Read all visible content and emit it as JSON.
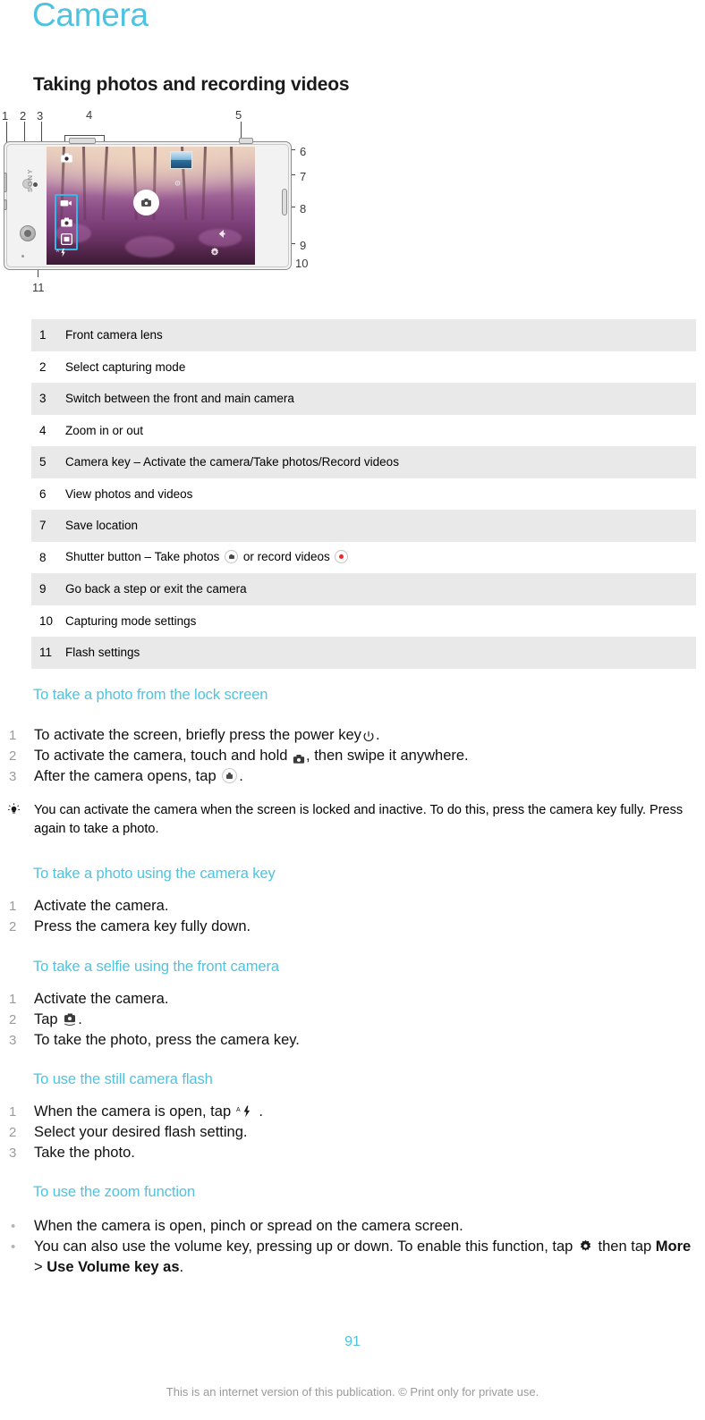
{
  "document": {
    "title": "Camera",
    "section_heading": "Taking photos and recording videos",
    "page_number": "91",
    "footer_note": "This is an internet version of this publication. © Print only for private use.",
    "accent_color": "#4ec3e0",
    "row_shade_color": "#e9e9e9"
  },
  "figure": {
    "name": "camera-screen-callout-diagram",
    "callout_numbers": [
      "1",
      "2",
      "3",
      "4",
      "5",
      "6",
      "7",
      "8",
      "9",
      "10",
      "11"
    ],
    "brand_text": "SONY",
    "highlight_color": "#39b6e8"
  },
  "reference_table": {
    "rows": [
      {
        "num": "1",
        "desc": "Front camera lens"
      },
      {
        "num": "2",
        "desc": "Select capturing mode"
      },
      {
        "num": "3",
        "desc": "Switch between the front and main camera"
      },
      {
        "num": "4",
        "desc": "Zoom in or out"
      },
      {
        "num": "5",
        "desc": "Camera key – Activate the camera/Take photos/Record videos"
      },
      {
        "num": "6",
        "desc": "View photos and videos"
      },
      {
        "num": "7",
        "desc": "Save location"
      },
      {
        "num": "8",
        "desc_before": "Shutter button – Take photos",
        "desc_middle": "or record videos",
        "desc_after": ""
      },
      {
        "num": "9",
        "desc": "Go back a step or exit the camera"
      },
      {
        "num": "10",
        "desc": "Capturing mode settings"
      },
      {
        "num": "11",
        "desc": "Flash settings"
      }
    ]
  },
  "sections": {
    "lock_screen": {
      "heading": "To take a photo from the lock screen",
      "step1_a": "To activate the screen, briefly press the power key",
      "step1_b": ".",
      "step2_a": "To activate the camera, touch and hold",
      "step2_b": ", then swipe it anywhere.",
      "step3_a": "After the camera opens, tap",
      "step3_b": ".",
      "markers": [
        "1",
        "2",
        "3"
      ],
      "tip": "You can activate the camera when the screen is locked and inactive. To do this, press the camera key fully. Press again to take a photo."
    },
    "camera_key": {
      "heading": "To take a photo using the camera key",
      "markers": [
        "1",
        "2"
      ],
      "steps": [
        "Activate the camera.",
        "Press the camera key fully down."
      ]
    },
    "selfie": {
      "heading": "To take a selfie using the front camera",
      "markers": [
        "1",
        "2",
        "3"
      ],
      "step1": "Activate the camera.",
      "step2_a": "Tap",
      "step2_b": ".",
      "step3": "To take the photo, press the camera key."
    },
    "flash": {
      "heading": "To use the still camera flash",
      "markers": [
        "1",
        "2",
        "3"
      ],
      "step1_a": "When the camera is open, tap",
      "step1_b": ".",
      "step2": "Select your desired flash setting.",
      "step3": "Take the photo."
    },
    "zoom": {
      "heading": "To use the zoom function",
      "markers": [
        "•",
        "•"
      ],
      "bullet1": "When the camera is open, pinch or spread on the camera screen.",
      "bullet2_a": "You can also use the volume key, pressing up or down. To enable this function, tap",
      "bullet2_b": "then tap",
      "bullet2_bold1": "More",
      "bullet2_sep": ">",
      "bullet2_bold2": "Use Volume key as",
      "bullet2_end": "."
    }
  }
}
